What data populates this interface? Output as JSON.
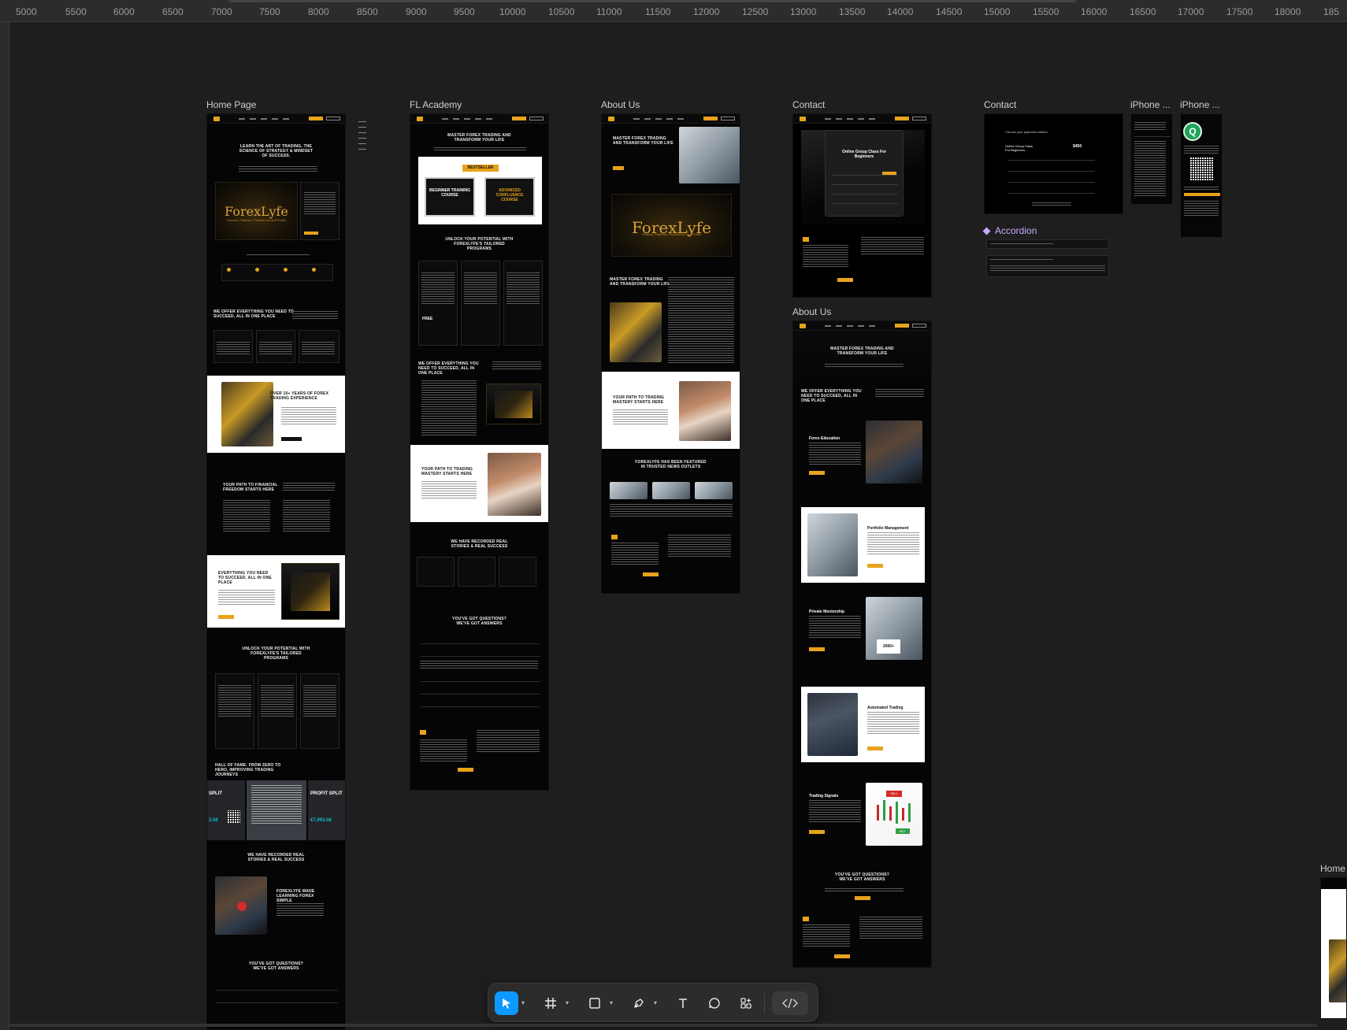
{
  "ruler": {
    "ticks": [
      "5000",
      "5500",
      "6000",
      "6500",
      "7000",
      "7500",
      "8000",
      "8500",
      "9000",
      "9500",
      "10000",
      "10500",
      "11000",
      "11500",
      "12000",
      "12500",
      "13000",
      "13500",
      "14000",
      "14500",
      "15000",
      "15500",
      "16000",
      "16500",
      "17000",
      "17500",
      "18000",
      "185"
    ]
  },
  "frames": {
    "home": {
      "label": "Home Page",
      "hero_title": "LEARN THE ART OF TRADING, THE SCIENCE OF STRATEGY & MINDSET OF SUCCESS.",
      "brand": "ForexLyfe",
      "brand_tag": "Passion, Patience, Persistence and Profits",
      "offer_title": "WE OFFER EVERYTHING YOU NEED TO SUCCEED, ALL IN ONE PLACE",
      "experience_title": "OVER 10+ YEARS OF FOREX TRADING EXPERIENCE",
      "path_title": "YOUR PATH TO FINANCIAL FREEDOM STARTS HERE",
      "everything_title": "EVERYTHING YOU NEED TO SUCCEED, ALL IN ONE PLACE",
      "unlock_title": "UNLOCK YOUR POTENTIAL WITH FOREXLYFE'S TAILORED PROGRAMS",
      "hall_title": "HALL OF FAME: FROM ZERO TO HERO, IMPROVING TRADING JOURNEYS",
      "profit_label_1": "SPLIT",
      "profit_label_2": "PROFIT SPLIT",
      "profit_amount_1": "3.08",
      "profit_amount_2": "€7,993.08",
      "stories_title": "WE HAVE RECORDED REAL STORIES & REAL SUCCESS",
      "stories_quote": "FOREXLYFE MADE LEARNING FOREX SIMPLE",
      "faq_title": "YOU'VE GOT QUESTIONS? WE'VE GOT ANSWERS"
    },
    "academy": {
      "label": "FL Academy",
      "hero_title": "MASTER FOREX TRADING AND TRANSFORM YOUR LIFE",
      "badge": "BESTSELLER",
      "course_1": "BEGINNER TRAINING COURSE",
      "course_2": "ADVANCED CONFLUENCE COURSE",
      "unlock_title": "UNLOCK YOUR POTENTIAL WITH FOREXLYFE'S TAILORED PROGRAMS",
      "offer_title": "WE OFFER EVERYTHING YOU NEED TO SUCCEED, ALL IN ONE PLACE",
      "path_title": "YOUR PATH TO TRADING MASTERY STARTS HERE",
      "stories_title": "WE HAVE RECORDED REAL STORIES & REAL SUCCESS",
      "faq_title": "YOU'VE GOT QUESTIONS? WE'VE GOT ANSWERS",
      "price_free": "FREE"
    },
    "about": {
      "label": "About Us",
      "hero_title": "MASTER FOREX TRADING AND TRANSFORM YOUR LIFE",
      "brand": "ForexLyfe",
      "brand_tag": "Passion, Patience, Persistence and Profits",
      "path_title": "YOUR PATH TO TRADING MASTERY STARTS HERE",
      "news_title": "FOREXLYFE HAS BEEN FEATURED IN TRUSTED NEWS OUTLETS"
    },
    "contact": {
      "label": "Contact",
      "modal_title": "Online Group Class For Beginners"
    },
    "contact2": {
      "label": "Contact",
      "heading": "Choose your payment method",
      "product": "Online Group Class For Beginners",
      "price": "$450"
    },
    "about2": {
      "label": "About Us",
      "hero_title": "MASTER FOREX TRADING AND TRANSFORM YOUR LIFE",
      "offer_title": "WE OFFER EVERYTHING YOU NEED TO SUCCEED, ALL IN ONE PLACE",
      "service_1": "Forex Education",
      "service_2": "Portfolio Management",
      "service_3": "Private Mentorship",
      "service_4": "Automated Trading",
      "service_5": "Trading Signals",
      "service_3_stat": "2000+",
      "faq_title": "YOU'VE GOT QUESTIONS? WE'VE GOT ANSWERS",
      "signal_sell": "SELL",
      "signal_buy": "BUY"
    },
    "phone1": {
      "label": "iPhone ..."
    },
    "phone2": {
      "label": "iPhone ...",
      "avatar_letter": "Q"
    },
    "home_partial": {
      "label": "Home"
    }
  },
  "accordion": {
    "label": "Accordion"
  },
  "toolbar": {
    "tools": [
      "move-tool",
      "frame-tool",
      "shape-tool",
      "pen-tool",
      "text-tool",
      "comment-tool",
      "actions-tool",
      "dev-mode-toggle"
    ]
  },
  "colors": {
    "canvas": "#1e1e1e",
    "accent": "#e8a21b",
    "selection": "#0d99ff",
    "component": "#c8a8ff"
  }
}
